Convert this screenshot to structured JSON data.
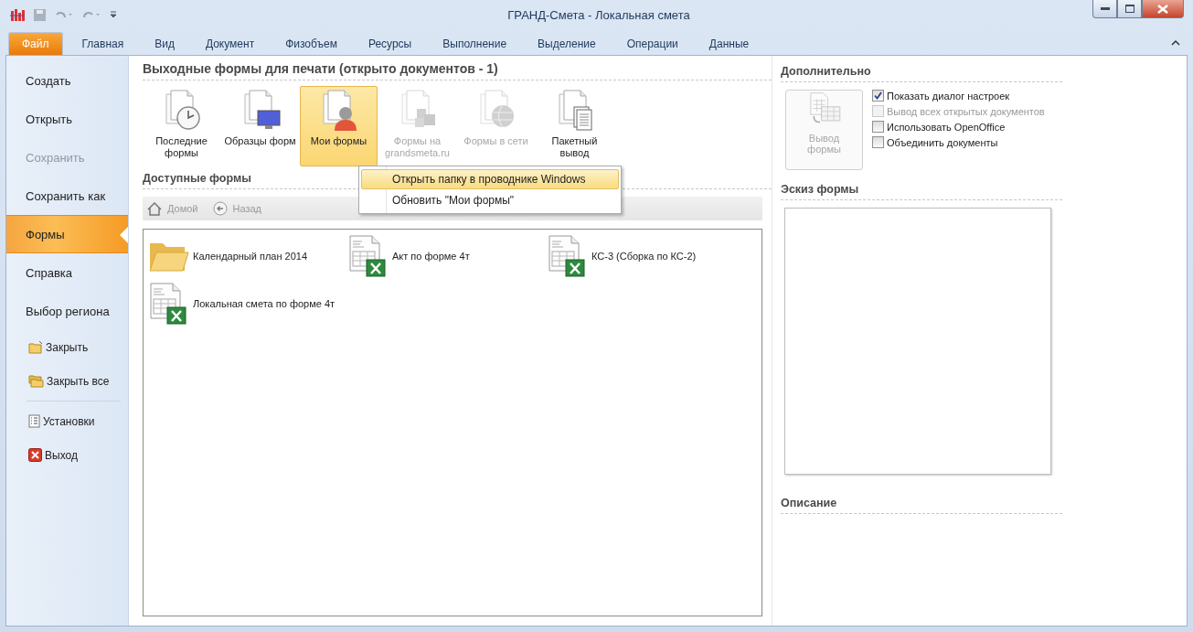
{
  "window": {
    "title": "ГРАНД-Смета - Локальная смета"
  },
  "tabs": [
    {
      "label": "Файл",
      "selected": true,
      "kind": "file"
    },
    {
      "label": "Главная",
      "selected": false,
      "kind": "tab"
    },
    {
      "label": "Вид",
      "selected": false,
      "kind": "tab"
    },
    {
      "label": "Документ",
      "selected": false,
      "kind": "tab"
    },
    {
      "label": "Физобъем",
      "selected": false,
      "kind": "tab"
    },
    {
      "label": "Ресурсы",
      "selected": false,
      "kind": "tab"
    },
    {
      "label": "Выполнение",
      "selected": false,
      "kind": "tab"
    },
    {
      "label": "Выделение",
      "selected": false,
      "kind": "tab"
    },
    {
      "label": "Операции",
      "selected": false,
      "kind": "tab"
    },
    {
      "label": "Данные",
      "selected": false,
      "kind": "tab"
    }
  ],
  "sidebar": {
    "items": [
      {
        "label": "Создать",
        "kind": "item",
        "selected": false,
        "disabled": false
      },
      {
        "label": "Открыть",
        "kind": "item",
        "selected": false,
        "disabled": false
      },
      {
        "label": "Сохранить",
        "kind": "item",
        "selected": false,
        "disabled": true
      },
      {
        "label": "Сохранить как",
        "kind": "item",
        "selected": false,
        "disabled": false
      },
      {
        "label": "Формы",
        "kind": "item",
        "selected": true,
        "disabled": false
      },
      {
        "label": "Справка",
        "kind": "item",
        "selected": false,
        "disabled": false
      },
      {
        "label": "Выбор региона",
        "kind": "item",
        "selected": false,
        "disabled": false
      },
      {
        "label": "Закрыть",
        "kind": "close",
        "selected": false,
        "disabled": false
      },
      {
        "label": "Закрыть все",
        "kind": "close-all",
        "selected": false,
        "disabled": false
      },
      {
        "label": "Установки",
        "kind": "settings",
        "selected": false,
        "disabled": false
      },
      {
        "label": "Выход",
        "kind": "exit",
        "selected": false,
        "disabled": false
      }
    ]
  },
  "main": {
    "heading": "Выходные формы для печати (открыто документов - 1)",
    "gallery": [
      {
        "label": "Последние формы",
        "selected": false,
        "disabled": false
      },
      {
        "label": "Образцы форм",
        "selected": false,
        "disabled": false
      },
      {
        "label": "Мои формы",
        "selected": true,
        "disabled": false
      },
      {
        "label": "Формы на grandsmeta.ru",
        "selected": false,
        "disabled": true
      },
      {
        "label": "Формы в сети",
        "selected": false,
        "disabled": true
      },
      {
        "label": "Пакетный вывод",
        "selected": false,
        "disabled": false
      }
    ],
    "context_menu": [
      {
        "label": "Открыть папку в проводнике Windows",
        "selected": true
      },
      {
        "label": "Обновить \"Мои формы\"",
        "selected": false
      }
    ],
    "available_heading": "Доступные формы",
    "nav": [
      {
        "label": "Домой",
        "kind": "home",
        "disabled": true
      },
      {
        "label": "Назад",
        "kind": "back",
        "disabled": true
      }
    ],
    "files": [
      {
        "name": "Календарный план 2014",
        "kind": "folder"
      },
      {
        "name": "Акт по форме 4т",
        "kind": "excel"
      },
      {
        "name": "КС-3 (Сборка по КС-2)",
        "kind": "excel"
      },
      {
        "name": "Локальная смета по форме 4т",
        "kind": "excel"
      }
    ]
  },
  "right": {
    "heading": "Дополнительно",
    "output_button": {
      "label": "Вывод формы",
      "disabled": true
    },
    "options": [
      {
        "label": "Показать диалог настроек",
        "checked": true,
        "disabled": false
      },
      {
        "label": "Вывод всех открытых документов",
        "checked": false,
        "disabled": true
      },
      {
        "label": "Использовать OpenOffice",
        "checked": false,
        "disabled": false
      },
      {
        "label": "Объединить документы",
        "checked": false,
        "disabled": false
      }
    ],
    "sketch_heading": "Эскиз формы",
    "description_heading": "Описание"
  }
}
